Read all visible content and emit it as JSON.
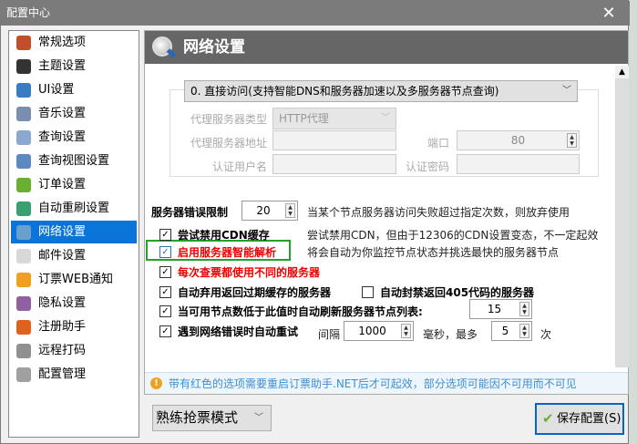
{
  "window": {
    "title": "配置中心",
    "close": "✕"
  },
  "sidebar": {
    "items": [
      {
        "label": "常规选项",
        "icon": "home-icon",
        "color": "#c0502a"
      },
      {
        "label": "主题设置",
        "icon": "magic-wand-icon",
        "color": "#333333"
      },
      {
        "label": "UI设置",
        "icon": "monitor-icon",
        "color": "#3a7cc4"
      },
      {
        "label": "音乐设置",
        "icon": "speaker-icon",
        "color": "#7a8fb0"
      },
      {
        "label": "查询设置",
        "icon": "chart-icon",
        "color": "#8aa8d0"
      },
      {
        "label": "查询视图设置",
        "icon": "magnifier-icon",
        "color": "#5a8ac0"
      },
      {
        "label": "订单设置",
        "icon": "basket-icon",
        "color": "#6ab030"
      },
      {
        "label": "自动重刷设置",
        "icon": "refresh-icon",
        "color": "#3aa070"
      },
      {
        "label": "网络设置",
        "icon": "globe-icon",
        "color": "#6aa0d0"
      },
      {
        "label": "邮件设置",
        "icon": "mail-icon",
        "color": "#d8d8d8"
      },
      {
        "label": "订票WEB通知",
        "icon": "rss-icon",
        "color": "#f0a020"
      },
      {
        "label": "隐私设置",
        "icon": "umbrella-icon",
        "color": "#9060a0"
      },
      {
        "label": "注册助手",
        "icon": "heart-icon",
        "color": "#e06020"
      },
      {
        "label": "远程打码",
        "icon": "key-icon",
        "color": "#909090"
      },
      {
        "label": "配置管理",
        "icon": "gear-icon",
        "color": "#a0a0a0"
      }
    ],
    "selected": 8
  },
  "panel": {
    "title": "网络设置",
    "access_mode": "0. 直接访问(支持智能DNS和服务器加速以及多服务器节点查询)",
    "proxy_type_label": "代理服务器类型",
    "proxy_type_value": "HTTP代理",
    "proxy_address_label": "代理服务器地址",
    "port_label": "端口",
    "port_value": "80",
    "auth_user_label": "认证用户名",
    "auth_password_label": "认证密码",
    "error_limit_label": "服务器错误限制",
    "error_limit_value": "20",
    "error_limit_hint": "当某个节点服务器访问失败超过指定次数，则放弃使用",
    "options": [
      {
        "label": "尝试禁用CDN缓存",
        "checked": true,
        "hint": "尝试禁用CDN，但由于12306的CDN设置变态，不一定起效"
      },
      {
        "label": "启用服务器智能解析",
        "checked": true,
        "hint": "将会自动为你监控节点状态并挑选最快的服务器节点"
      },
      {
        "label": "每次查票都使用不同的服务器",
        "checked": true
      },
      {
        "label": "自动弃用返回过期缓存的服务器",
        "checked": true
      },
      {
        "label": "自动封禁返回405代码的服务器",
        "checked": false
      },
      {
        "label": "当可用节点数低于此值时自动刷新服务器节点列表:",
        "checked": true,
        "value": "15"
      },
      {
        "label": "遇到网络错误时自动重试",
        "checked": true
      }
    ],
    "retry_interval_label": "间隔",
    "retry_interval_value": "1000",
    "retry_ms_label": "毫秒，最多",
    "retry_max_value": "5",
    "retry_times_label": "次",
    "notice": "带有红色的选项需要重启订票助手.NET后才可起效，部分选项可能因不可用而不可见"
  },
  "footer": {
    "mode": "熟练抢票模式",
    "save": "保存配置(S)"
  }
}
